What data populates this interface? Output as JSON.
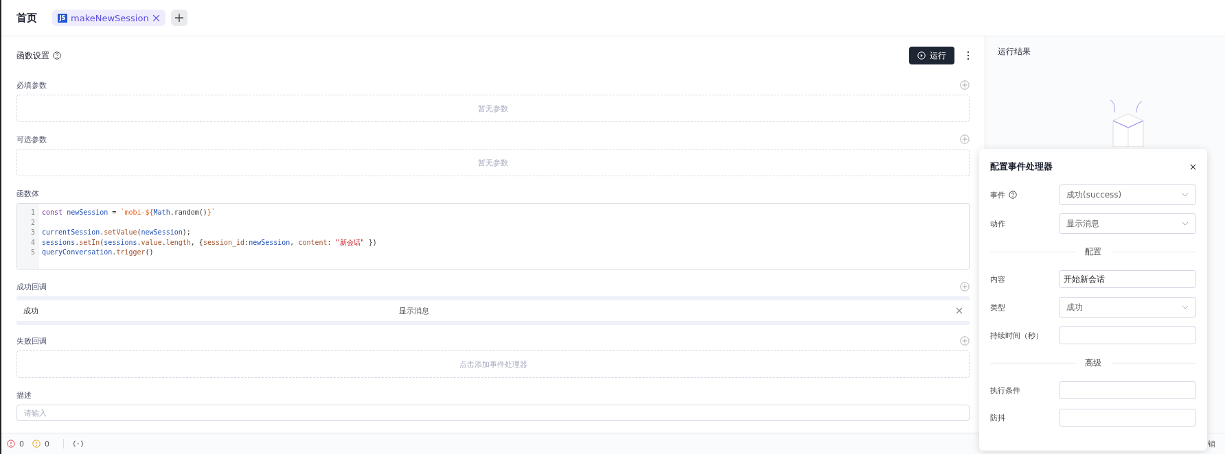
{
  "top_bar": {
    "home": "首页",
    "tabs": [
      {
        "badge": "JS",
        "label": "makeNewSession",
        "selected": true
      }
    ]
  },
  "function_settings": {
    "title": "函数设置",
    "run_button": "运行",
    "required_params": {
      "label": "必填参数",
      "empty": "暂无参数"
    },
    "optional_params": {
      "label": "可选参数",
      "empty": "暂无参数"
    },
    "body": {
      "label": "函数体",
      "lines": [
        {
          "number": "1",
          "tokens": [
            {
              "text": "const ",
              "kind": "keyword"
            },
            {
              "text": "newSession",
              "kind": "variable"
            },
            {
              "text": " = ",
              "kind": "plain"
            },
            {
              "text": "`mobi-${",
              "kind": "string"
            },
            {
              "text": "Math",
              "kind": "variable"
            },
            {
              "text": ".random()",
              "kind": "plain"
            },
            {
              "text": "}`",
              "kind": "string"
            }
          ]
        },
        {
          "number": "2"
        },
        {
          "number": "3",
          "tokens": [
            {
              "text": "currentSession",
              "kind": "variable"
            },
            {
              "text": ".",
              "kind": "plain"
            },
            {
              "text": "setValue",
              "kind": "method"
            },
            {
              "text": "(",
              "kind": "plain"
            },
            {
              "text": "newSession",
              "kind": "variable"
            },
            {
              "text": ");",
              "kind": "plain"
            }
          ]
        },
        {
          "number": "4",
          "tokens": [
            {
              "text": "sessions",
              "kind": "variable"
            },
            {
              "text": ".",
              "kind": "plain"
            },
            {
              "text": "setIn",
              "kind": "method"
            },
            {
              "text": "(",
              "kind": "plain"
            },
            {
              "text": "sessions",
              "kind": "variable"
            },
            {
              "text": ".",
              "kind": "plain"
            },
            {
              "text": "value",
              "kind": "method"
            },
            {
              "text": ".",
              "kind": "plain"
            },
            {
              "text": "length",
              "kind": "method"
            },
            {
              "text": ", {",
              "kind": "plain"
            },
            {
              "text": "session_id",
              "kind": "method"
            },
            {
              "text": ":",
              "kind": "plain"
            },
            {
              "text": "newSession",
              "kind": "variable"
            },
            {
              "text": ", ",
              "kind": "plain"
            },
            {
              "text": "content",
              "kind": "method"
            },
            {
              "text": ": ",
              "kind": "plain"
            },
            {
              "text": "\"新会话\"",
              "kind": "literal"
            },
            {
              "text": " })",
              "kind": "plain"
            }
          ]
        },
        {
          "number": "5",
          "tokens": [
            {
              "text": "queryConversation",
              "kind": "variable"
            },
            {
              "text": ".",
              "kind": "plain"
            },
            {
              "text": "trigger",
              "kind": "method"
            },
            {
              "text": "()",
              "kind": "plain"
            }
          ]
        }
      ]
    },
    "success_callback": {
      "label": "成功回调",
      "handlers": [
        {
          "event": "成功",
          "action": "显示消息"
        }
      ]
    },
    "failure_callback": {
      "label": "失败回调",
      "empty": "点击添加事件处理器"
    },
    "description": {
      "label": "描述",
      "placeholder": "请输入"
    }
  },
  "results": {
    "title": "运行结果"
  },
  "event_handler_popup": {
    "title": "配置事件处理器",
    "rows": [
      {
        "kind": "select",
        "label": "事件",
        "help": true,
        "value": "成功(success)"
      },
      {
        "kind": "select",
        "label": "动作",
        "help": false,
        "value": "显示消息"
      },
      {
        "kind": "divider",
        "label": "配置"
      },
      {
        "kind": "input",
        "label": "内容",
        "value": "开始新会话"
      },
      {
        "kind": "select",
        "label": "类型",
        "help": false,
        "value": "成功"
      },
      {
        "kind": "input",
        "label": "持续时间（秒）"
      },
      {
        "kind": "divider",
        "label": "高级"
      },
      {
        "kind": "input",
        "label": "执行条件"
      },
      {
        "kind": "input",
        "label": "防抖"
      }
    ]
  },
  "status_bar": {
    "errors": "0",
    "warnings": "0",
    "right_text": "销"
  }
}
